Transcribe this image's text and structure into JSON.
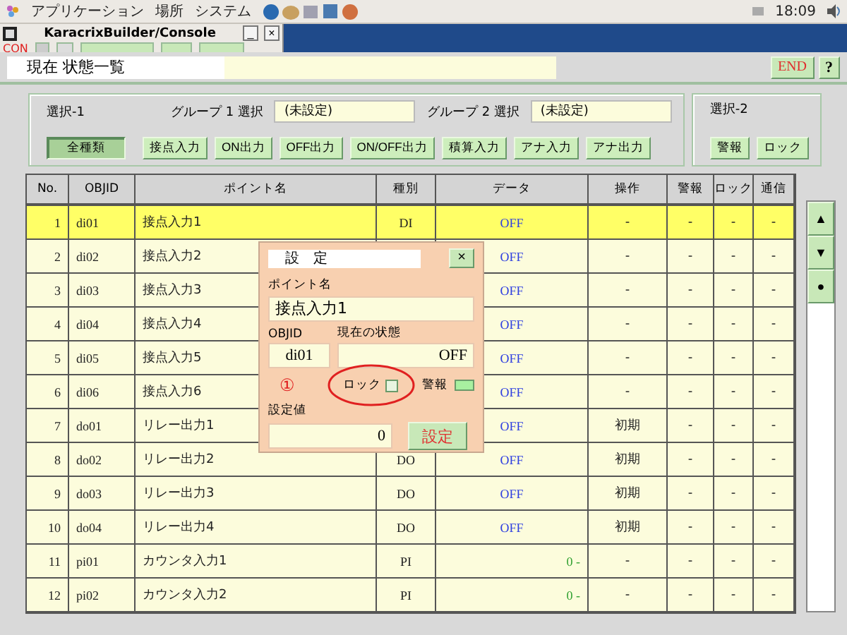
{
  "top_panel": {
    "menu": [
      "アプリケーション",
      "場所",
      "システム"
    ],
    "clock": "18:09"
  },
  "console_window": {
    "title": "KaracrixBuilder/Console",
    "minimize": "_",
    "close": "×",
    "label": "CON"
  },
  "header": {
    "title": "現在 状態一覧",
    "end_button": "END",
    "help_button": "?"
  },
  "selection_1": {
    "label": "選択-1",
    "groups": [
      {
        "label": "グループ 1 選択",
        "value": "(未設定)"
      },
      {
        "label": "グループ 2 選択",
        "value": "(未設定)"
      }
    ],
    "buttons": [
      {
        "label": "全種類",
        "selected": true
      },
      {
        "label": "接点入力",
        "selected": false
      },
      {
        "label": "ON出力",
        "selected": false
      },
      {
        "label": "OFF出力",
        "selected": false
      },
      {
        "label": "ON/OFF出力",
        "selected": false
      },
      {
        "label": "積算入力",
        "selected": false
      },
      {
        "label": "アナ入力",
        "selected": false
      },
      {
        "label": "アナ出力",
        "selected": false
      }
    ]
  },
  "selection_2": {
    "label": "選択-2",
    "buttons": [
      {
        "label": "警報",
        "selected": false
      },
      {
        "label": "ロック",
        "selected": false
      }
    ]
  },
  "table": {
    "columns": [
      "No.",
      "OBJID",
      "ポイント名",
      "種別",
      "データ",
      "操作",
      "警報",
      "ロック",
      "通信"
    ],
    "rows": [
      {
        "no": "1",
        "objid": "di01",
        "name": "接点入力1",
        "type": "DI",
        "kind": "digital",
        "data": "OFF",
        "operation": "-",
        "alarm": "-",
        "lock": "-",
        "comm": "-",
        "selected": true
      },
      {
        "no": "2",
        "objid": "di02",
        "name": "接点入力2",
        "kind": "digital",
        "data": "OFF",
        "operation": "-",
        "alarm": "-",
        "lock": "-",
        "comm": "-",
        "selected": false
      },
      {
        "no": "3",
        "objid": "di03",
        "name": "接点入力3",
        "kind": "digital",
        "data": "OFF",
        "operation": "-",
        "alarm": "-",
        "lock": "-",
        "comm": "-",
        "selected": false
      },
      {
        "no": "4",
        "objid": "di04",
        "name": "接点入力4",
        "kind": "digital",
        "data": "OFF",
        "operation": "-",
        "alarm": "-",
        "lock": "-",
        "comm": "-",
        "selected": false
      },
      {
        "no": "5",
        "objid": "di05",
        "name": "接点入力5",
        "kind": "digital",
        "data": "OFF",
        "operation": "-",
        "alarm": "-",
        "lock": "-",
        "comm": "-",
        "selected": false
      },
      {
        "no": "6",
        "objid": "di06",
        "name": "接点入力6",
        "kind": "digital",
        "data": "OFF",
        "operation": "-",
        "alarm": "-",
        "lock": "-",
        "comm": "-",
        "selected": false
      },
      {
        "no": "7",
        "objid": "do01",
        "name": "リレー出力1",
        "kind": "digital",
        "data": "OFF",
        "operation": "初期",
        "alarm": "-",
        "lock": "-",
        "comm": "-",
        "selected": false
      },
      {
        "no": "8",
        "objid": "do02",
        "name": "リレー出力2",
        "type": "DO",
        "kind": "digital",
        "data": "OFF",
        "operation": "初期",
        "alarm": "-",
        "lock": "-",
        "comm": "-",
        "selected": false
      },
      {
        "no": "9",
        "objid": "do03",
        "name": "リレー出力3",
        "type": "DO",
        "kind": "digital",
        "data": "OFF",
        "operation": "初期",
        "alarm": "-",
        "lock": "-",
        "comm": "-",
        "selected": false
      },
      {
        "no": "10",
        "objid": "do04",
        "name": "リレー出力4",
        "type": "DO",
        "kind": "digital",
        "data": "OFF",
        "operation": "初期",
        "alarm": "-",
        "lock": "-",
        "comm": "-",
        "selected": false
      },
      {
        "no": "11",
        "objid": "pi01",
        "name": "カウンタ入力1",
        "type": "PI",
        "kind": "analog",
        "data": "0",
        "unit": "-",
        "operation": "-",
        "alarm": "-",
        "lock": "-",
        "comm": "-",
        "selected": false
      },
      {
        "no": "12",
        "objid": "pi02",
        "name": "カウンタ入力2",
        "type": "PI",
        "kind": "analog",
        "data": "0",
        "unit": "-",
        "operation": "-",
        "alarm": "-",
        "lock": "-",
        "comm": "-",
        "selected": false
      }
    ]
  },
  "scroll_buttons": [
    "▲",
    "▼",
    "●"
  ],
  "dialog": {
    "title": "設　定",
    "close": "×",
    "point_name_label": "ポイント名",
    "point_name": "接点入力1",
    "objid_label": "OBJID",
    "objid": "di01",
    "state_label": "現在の状態",
    "state": "OFF",
    "marker": "①",
    "lock_label": "ロック",
    "lock_checked": false,
    "alarm_label": "警報",
    "setpoint_label": "設定値",
    "setpoint": "0",
    "set_button": "設定"
  }
}
